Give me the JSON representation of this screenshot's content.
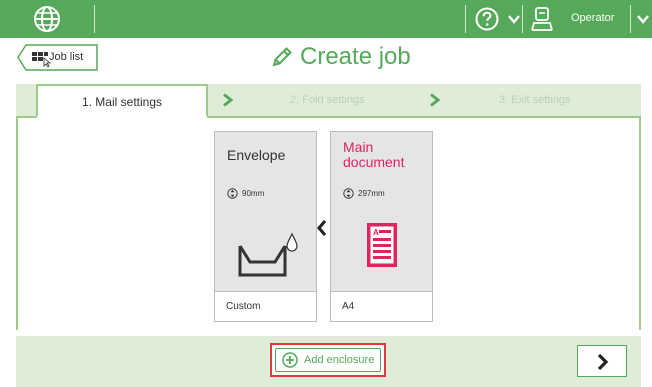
{
  "colors": {
    "accent": "#56a95a",
    "light_green": "#deecd8",
    "highlight": "#e53935",
    "main_doc": "#e0245e"
  },
  "topbar": {
    "home_icon": "globe-icon",
    "help_icon": "help-icon",
    "user_icon": "user-icon",
    "user_label": "Operator"
  },
  "header": {
    "back_label": "Job list",
    "title": "Create job",
    "title_icon": "pencil-icon"
  },
  "tabs": [
    {
      "label": "1. Mail settings",
      "active": true
    },
    {
      "label": "2. Fold settings",
      "active": false
    },
    {
      "label": "3. Exit settings",
      "active": false
    }
  ],
  "cards": [
    {
      "name": "Envelope",
      "dimension": "90mm",
      "type": "Custom",
      "icon": "envelope-icon"
    },
    {
      "name": "Main document",
      "name_line1": "Main",
      "name_line2": "document",
      "dimension": "297mm",
      "type": "A4",
      "icon": "document-icon"
    }
  ],
  "footer": {
    "add_label": "Add enclosure",
    "next_icon": "chevron-right-icon"
  }
}
